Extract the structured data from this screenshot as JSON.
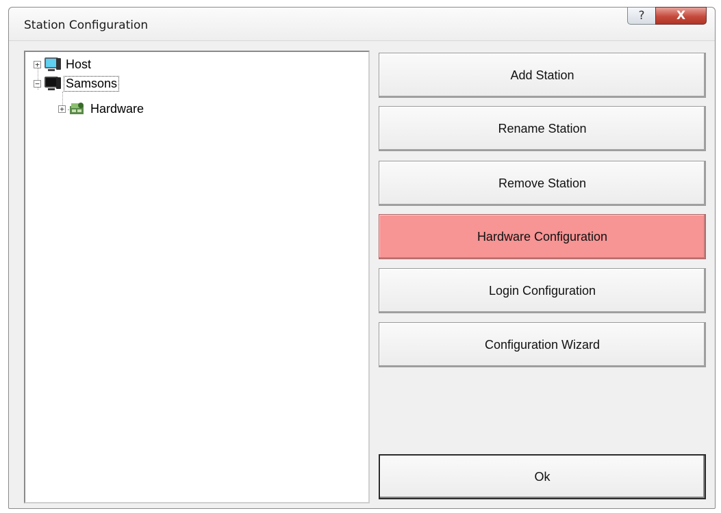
{
  "window": {
    "title": "Station Configuration",
    "help_label": "?",
    "close_label": "X"
  },
  "tree": {
    "items": [
      {
        "label": "Host",
        "expander": "+",
        "icon": "monitor-icon"
      },
      {
        "label": "Samsons",
        "expander": "−",
        "icon": "monitor-icon",
        "selected": true
      },
      {
        "label": "Hardware",
        "expander": "+",
        "icon": "hardware-icon"
      }
    ]
  },
  "buttons": {
    "add_station": "Add Station",
    "rename_station": "Rename Station",
    "remove_station": "Remove Station",
    "hardware_configuration": "Hardware Configuration",
    "login_configuration": "Login Configuration",
    "configuration_wizard": "Configuration Wizard",
    "ok": "Ok"
  },
  "colors": {
    "active_button": "#f79494",
    "close_button": "#c44a3c"
  }
}
